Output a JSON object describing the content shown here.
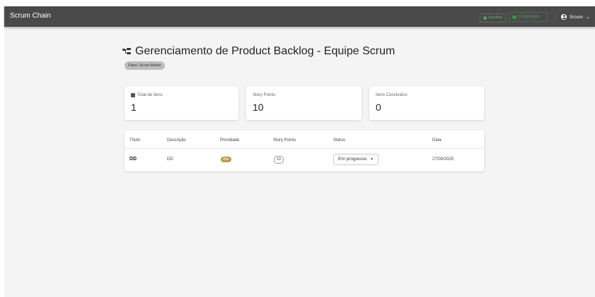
{
  "app": {
    "title": "Scrum Chain"
  },
  "header": {
    "network_chip": "Hardhat",
    "wallet_chip": "Conectado",
    "user_label": "Srcum"
  },
  "page": {
    "title": "Gerenciamento de Product Backlog - Equipe Scrum",
    "role_chip": "Papel: Scrum Master"
  },
  "stats": [
    {
      "label": "Total de Itens",
      "value": "1",
      "icon": "list-icon"
    },
    {
      "label": "Story Points",
      "value": "10"
    },
    {
      "label": "Itens Concluídos",
      "value": "0"
    }
  ],
  "table": {
    "columns": [
      "Título",
      "Descrição",
      "Prioridade",
      "Story Points",
      "Status",
      "Data"
    ],
    "rows": [
      {
        "titulo": "DD",
        "descricao": "DD",
        "prioridade": "Alta",
        "story_points": "10",
        "status": "Em progresso",
        "data": "27/09/2025"
      }
    ]
  },
  "colors": {
    "topbar": "#4a4a4a",
    "background": "#f4f4f4",
    "priority_high": "#b89a43",
    "connected_green": "#4e9a51"
  }
}
